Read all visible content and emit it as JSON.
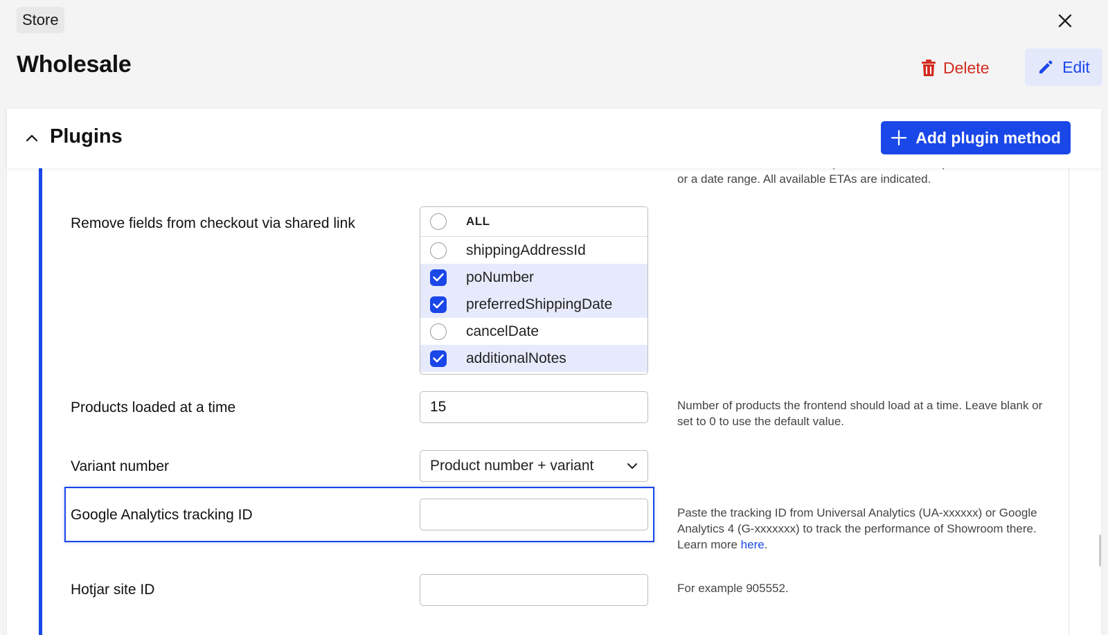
{
  "breadcrumb": {
    "label": "Store"
  },
  "page": {
    "title": "Wholesale"
  },
  "actions": {
    "delete_label": "Delete",
    "edit_label": "Edit"
  },
  "panel": {
    "title": "Plugins",
    "add_label": "Add plugin method"
  },
  "clipped_help": {
    "line1": "estimated times of arrival. It's possible to select a specific date",
    "line2": "or a date range. All available ETAs are indicated."
  },
  "remove_fields": {
    "label": "Remove fields from checkout via shared link",
    "all_label": "ALL",
    "options": [
      {
        "label": "shippingAddressId",
        "checked": false
      },
      {
        "label": "poNumber",
        "checked": true
      },
      {
        "label": "preferredShippingDate",
        "checked": true
      },
      {
        "label": "cancelDate",
        "checked": false
      },
      {
        "label": "additionalNotes",
        "checked": true
      }
    ]
  },
  "products_loaded": {
    "label": "Products loaded at a time",
    "value": "15",
    "help": "Number of products the frontend should load at a time. Leave blank or set to 0 to use the default value."
  },
  "variant_number": {
    "label": "Variant number",
    "selected": "Product number + variant"
  },
  "ga_tracking": {
    "label": "Google Analytics tracking ID",
    "value": "",
    "help": "Paste the tracking ID from Universal Analytics (UA-xxxxxx) or Google Analytics 4 (G-xxxxxxx) to track the performance of Showroom there. Learn more",
    "help_link": "here",
    "help_end": "."
  },
  "hotjar": {
    "label": "Hotjar site ID",
    "value": "",
    "help": "For example 905552."
  },
  "colors": {
    "accent": "#1a47e8",
    "danger": "#d22b1f",
    "edit_bg": "#e3e8fb",
    "checked_row_bg": "#e6eafc"
  },
  "icons": {
    "close": "close-icon",
    "delete": "trash-icon",
    "edit": "pencil-icon",
    "collapse": "chevron-up-icon",
    "add": "plus-icon",
    "select": "chevron-down-icon",
    "check": "check-icon"
  }
}
